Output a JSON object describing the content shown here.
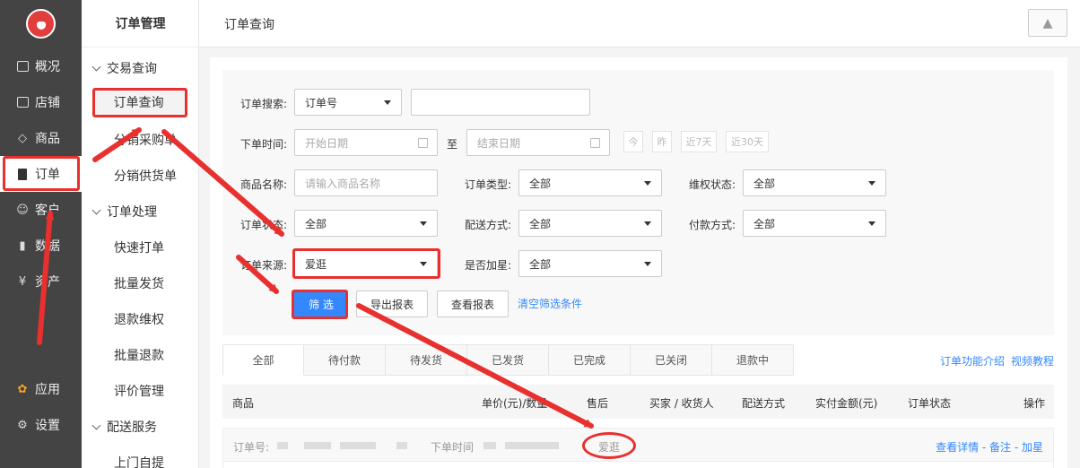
{
  "sidebar": {
    "items": [
      {
        "label": "概况",
        "icon": "monitor-icon"
      },
      {
        "label": "店铺",
        "icon": "store-icon"
      },
      {
        "label": "商品",
        "icon": "tag-icon"
      },
      {
        "label": "订单",
        "icon": "document-icon"
      },
      {
        "label": "客户",
        "icon": "user-icon"
      },
      {
        "label": "数据",
        "icon": "bar-chart-icon"
      },
      {
        "label": "资产",
        "icon": "yen-icon"
      },
      {
        "label": "应用",
        "icon": "apps-icon"
      },
      {
        "label": "设置",
        "icon": "gear-icon"
      }
    ]
  },
  "subnav": {
    "title": "订单管理",
    "group1": "交易查询",
    "group1_items": [
      "订单查询",
      "分销采购单",
      "分销供货单"
    ],
    "group2": "订单处理",
    "group2_items": [
      "快速打单",
      "批量发货",
      "退款维权",
      "批量退款",
      "评价管理"
    ],
    "group3": "配送服务",
    "group3_items": [
      "上门自提"
    ]
  },
  "header": {
    "title": "订单查询"
  },
  "filter": {
    "search_label": "订单搜索:",
    "search_type": "订单号",
    "time_label": "下单时间:",
    "start_placeholder": "开始日期",
    "to_label": "至",
    "end_placeholder": "结束日期",
    "quick": [
      "今",
      "昨",
      "近7天",
      "近30天"
    ],
    "goods_label": "商品名称:",
    "goods_placeholder": "请输入商品名称",
    "type_label": "订单类型:",
    "type_value": "全部",
    "rights_label": "维权状态:",
    "rights_value": "全部",
    "status_label": "订单状态:",
    "status_value": "全部",
    "delivery_label": "配送方式:",
    "delivery_value": "全部",
    "pay_label": "付款方式:",
    "pay_value": "全部",
    "source_label": "订单来源:",
    "source_value": "爱逛",
    "star_label": "是否加星:",
    "star_value": "全部",
    "filter_btn": "筛 选",
    "export_btn": "导出报表",
    "view_btn": "查看报表",
    "clear_link": "清空筛选条件"
  },
  "tabs": [
    "全部",
    "待付款",
    "待发货",
    "已发货",
    "已完成",
    "已关闭",
    "退款中"
  ],
  "tab_links": [
    "订单功能介绍",
    "视频教程"
  ],
  "table": {
    "headers": [
      "商品",
      "单价(元)/数量",
      "售后",
      "买家 / 收货人",
      "配送方式",
      "实付金额(元)",
      "订单状态",
      "操作"
    ],
    "row": {
      "order_no_label": "订单号:",
      "time_label": "下单时间",
      "source": "爱逛",
      "actions": "查看详情 - 备注 - 加星"
    }
  }
}
